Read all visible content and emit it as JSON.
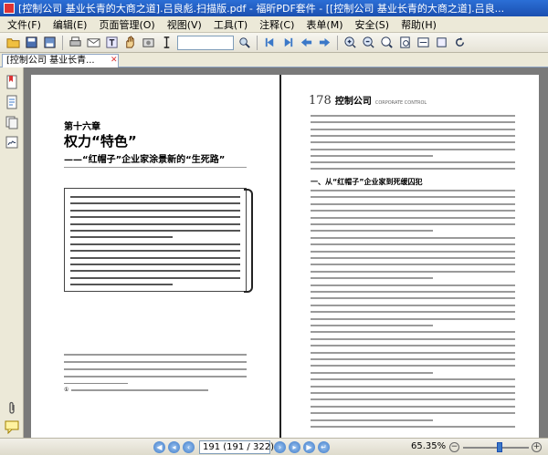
{
  "window": {
    "title": "[控制公司 基业长青的大商之道].吕良彪.扫描版.pdf - 福昕PDF套件 - [[控制公司 基业长青的大商之道].吕良..."
  },
  "menu": {
    "items": [
      "文件(F)",
      "编辑(E)",
      "页面管理(O)",
      "视图(V)",
      "工具(T)",
      "注释(C)",
      "表单(M)",
      "安全(S)",
      "帮助(H)"
    ]
  },
  "toolbar": {
    "search_value": ""
  },
  "tab": {
    "label": "[控制公司 基业长青..."
  },
  "document": {
    "left_page": {
      "chapter_number": "第十六章",
      "chapter_title": "权力“特色”",
      "chapter_subtitle": "——“红帽子”企业家涂景新的“生死路”",
      "footnote_marker": "①"
    },
    "right_page": {
      "page_number": "178",
      "book_title": "控制公司",
      "book_title_en": "CORPORATE CONTROL",
      "section_heading": "一、从“红帽子”企业家到死缓囚犯"
    }
  },
  "status": {
    "page_field": "191 (191 / 322)",
    "zoom": "65.35%",
    "zoom_level_fraction": 0.55
  },
  "colors": {
    "titlebar": "#2b6fd6",
    "doc_background": "#7a7a7a",
    "accent_blue": "#3b78c8"
  }
}
